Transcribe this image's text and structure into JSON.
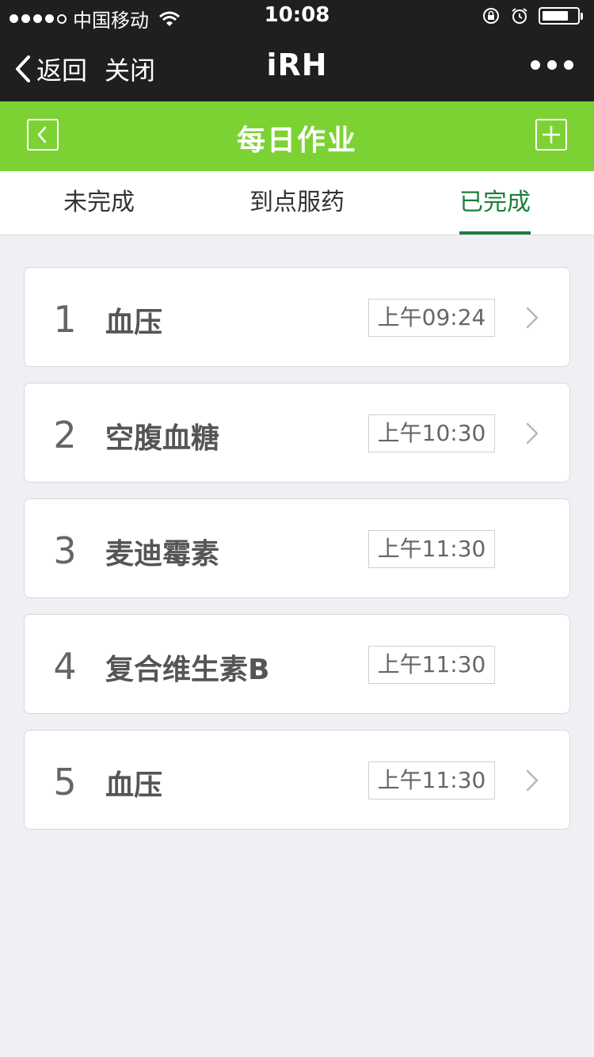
{
  "status_bar": {
    "carrier": "中国移动",
    "time": "10:08"
  },
  "wechat_nav": {
    "back_label": "返回",
    "close_label": "关闭",
    "title": "iRH"
  },
  "app_header": {
    "title": "每日作业"
  },
  "tabs": [
    {
      "label": "未完成"
    },
    {
      "label": "到点服药"
    },
    {
      "label": "已完成"
    }
  ],
  "active_tab": "已完成",
  "items": [
    {
      "index": "1",
      "name": "血压",
      "time": "上午09:24",
      "has_chevron": true
    },
    {
      "index": "2",
      "name": "空腹血糖",
      "time": "上午10:30",
      "has_chevron": true
    },
    {
      "index": "3",
      "name": "麦迪霉素",
      "time": "上午11:30",
      "has_chevron": false
    },
    {
      "index": "4",
      "name": "复合维生素B",
      "time": "上午11:30",
      "has_chevron": false
    },
    {
      "index": "5",
      "name": "血压",
      "time": "上午11:30",
      "has_chevron": true
    }
  ],
  "colors": {
    "nav_dark": "#1f1f22",
    "header_green": "#7cd233",
    "active_tab_green": "#1a7e3a",
    "background": "#efeff4"
  },
  "icons": {
    "back": "chevron-left-icon",
    "more": "more-dots-icon",
    "header_back": "square-back-icon",
    "header_add": "square-plus-icon",
    "row_chevron": "chevron-right-icon"
  }
}
